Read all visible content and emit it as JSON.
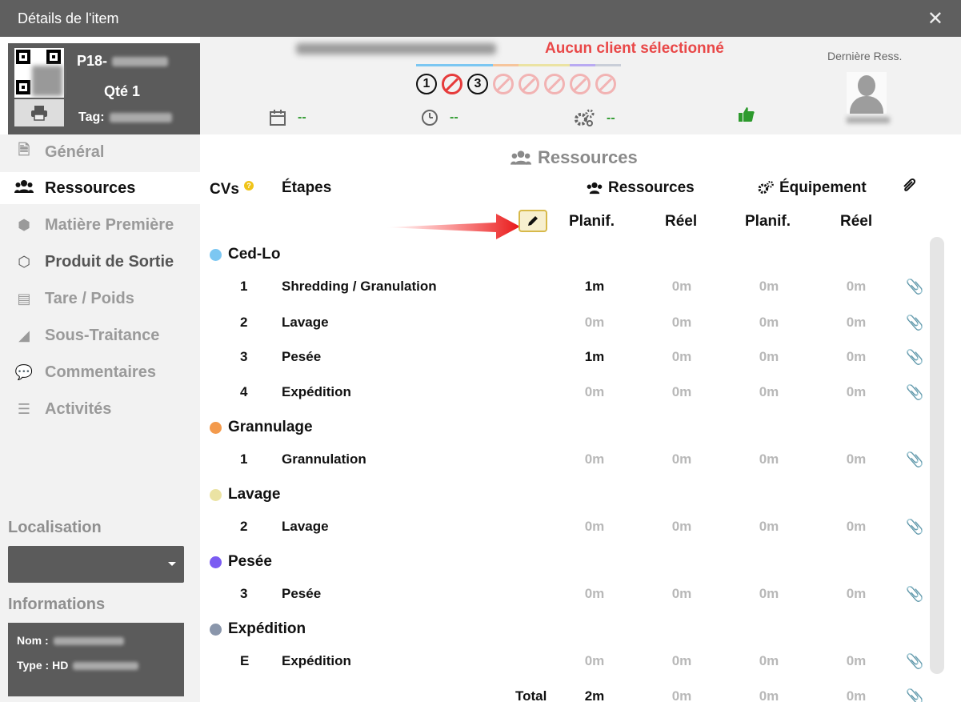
{
  "window": {
    "title": "Détails de l'item",
    "close_glyph": "✕"
  },
  "card": {
    "id_prefix": "P18-",
    "qty_label": "Qté 1",
    "tag_label": "Tag:",
    "print_icon": "printer-icon"
  },
  "top": {
    "client_status": "Aucun client sélectionné",
    "last_resource_label": "Dernière Ress.",
    "date_value": "--",
    "time_value": "--",
    "gears_value": "--",
    "step_icons": [
      "1",
      "no",
      "3",
      "no",
      "no",
      "no",
      "no",
      "no"
    ],
    "accent_colors": {
      "status_red": "#e94848",
      "ok_green": "#2f9a2f"
    }
  },
  "sidebar": {
    "items": [
      {
        "label": "Général",
        "icon": "document-icon"
      },
      {
        "label": "Ressources",
        "icon": "users-icon"
      },
      {
        "label": "Matière Première",
        "icon": "cubes-icon"
      },
      {
        "label": "Produit de Sortie",
        "icon": "cube-icon"
      },
      {
        "label": "Tare / Poids",
        "icon": "archive-icon"
      },
      {
        "label": "Sous-Traitance",
        "icon": "area-chart-icon"
      },
      {
        "label": "Commentaires",
        "icon": "comments-icon"
      },
      {
        "label": "Activités",
        "icon": "list-icon"
      }
    ],
    "location_title": "Localisation",
    "info_title": "Informations",
    "info_nom_label": "Nom :",
    "info_type_label": "Type : HD"
  },
  "main": {
    "section_title": "Ressources",
    "headers": {
      "cvs": "CVs",
      "etapes": "Étapes",
      "ressources": "Ressources",
      "equipement": "Équipement",
      "planif_res": "Planif.",
      "reel_res": "Réel",
      "planif_eq": "Planif.",
      "reel_eq": "Réel"
    },
    "groups": [
      {
        "name": "Ced-Lo",
        "color": "#7cc7f2"
      },
      {
        "name": "Grannulage",
        "color": "#f39a4c"
      },
      {
        "name": "Lavage",
        "color": "#ebe3a3"
      },
      {
        "name": "Pesée",
        "color": "#7b5cf2"
      },
      {
        "name": "Expédition",
        "color": "#8a96ab"
      }
    ],
    "rows": [
      {
        "num": "1",
        "step": "Shredding / Granulation",
        "planif": "1m",
        "reel": "0m",
        "eq_planif": "0m",
        "eq_reel": "0m"
      },
      {
        "num": "2",
        "step": "Lavage",
        "planif": "0m",
        "reel": "0m",
        "eq_planif": "0m",
        "eq_reel": "0m"
      },
      {
        "num": "3",
        "step": "Pesée",
        "planif": "1m",
        "reel": "0m",
        "eq_planif": "0m",
        "eq_reel": "0m"
      },
      {
        "num": "4",
        "step": "Expédition",
        "planif": "0m",
        "reel": "0m",
        "eq_planif": "0m",
        "eq_reel": "0m"
      },
      {
        "num": "1",
        "step": "Grannulation",
        "planif": "0m",
        "reel": "0m",
        "eq_planif": "0m",
        "eq_reel": "0m"
      },
      {
        "num": "2",
        "step": "Lavage",
        "planif": "0m",
        "reel": "0m",
        "eq_planif": "0m",
        "eq_reel": "0m"
      },
      {
        "num": "3",
        "step": "Pesée",
        "planif": "0m",
        "reel": "0m",
        "eq_planif": "0m",
        "eq_reel": "0m"
      },
      {
        "num": "E",
        "step": "Expédition",
        "planif": "0m",
        "reel": "0m",
        "eq_planif": "0m",
        "eq_reel": "0m"
      }
    ],
    "total": {
      "label": "Total",
      "planif": "2m",
      "reel": "0m",
      "eq_planif": "0m",
      "eq_reel": "0m"
    }
  }
}
